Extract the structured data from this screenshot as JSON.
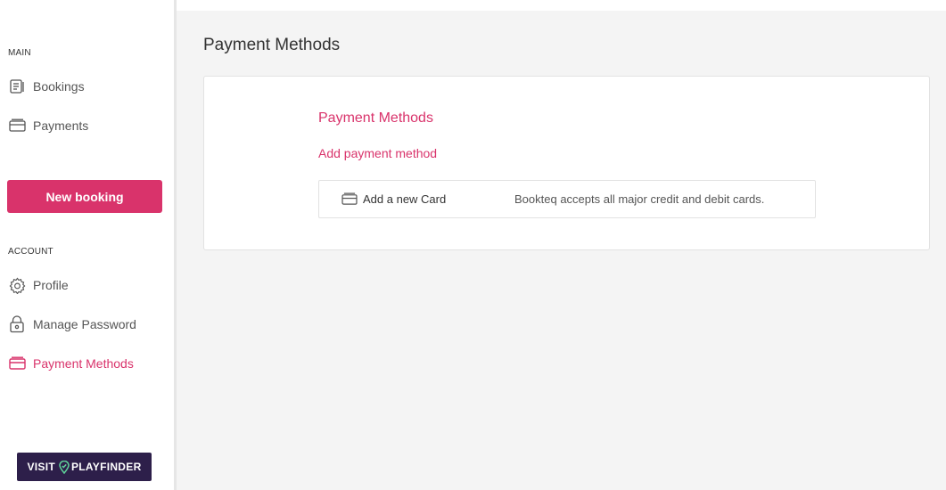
{
  "sidebar": {
    "main_label": "MAIN",
    "main_items": [
      {
        "label": "Bookings",
        "icon": "bookings-icon"
      },
      {
        "label": "Payments",
        "icon": "card-icon"
      }
    ],
    "new_booking_label": "New booking",
    "account_label": "ACCOUNT",
    "account_items": [
      {
        "label": "Profile",
        "icon": "gear-icon"
      },
      {
        "label": "Manage Password",
        "icon": "lock-icon"
      },
      {
        "label": "Payment Methods",
        "icon": "card-icon",
        "active": true
      }
    ],
    "visit_badge": {
      "prefix": "VISIT",
      "brand": "PLAYFINDER"
    }
  },
  "main": {
    "page_title": "Payment Methods",
    "card": {
      "title": "Payment Methods",
      "add_link": "Add payment method",
      "option": {
        "label": "Add a new Card",
        "description": "Bookteq accepts all major credit and debit cards.",
        "icon": "card-icon"
      }
    }
  },
  "colors": {
    "accent": "#d9336b",
    "badge_bg": "#2d1f4a",
    "main_bg": "#f4f4f4"
  }
}
